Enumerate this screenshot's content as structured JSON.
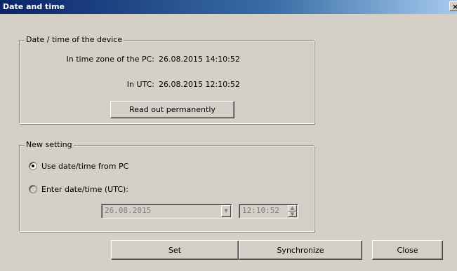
{
  "window": {
    "title": "Date and time",
    "close_glyph": "×"
  },
  "device_group": {
    "legend": "Date / time of the device",
    "pc_label": "In time zone of the PC:",
    "pc_value": "26.08.2015 14:10:52",
    "utc_label": "In UTC:",
    "utc_value": "26.08.2015 12:10:52",
    "read_button": "Read out permanently"
  },
  "new_setting_group": {
    "legend": "New setting",
    "option_pc": {
      "label": "Use date/time from PC",
      "checked": true
    },
    "option_manual": {
      "label": "Enter date/time (UTC):",
      "checked": false
    },
    "date_value": "26.08.2015",
    "time_value": "12:10:52"
  },
  "buttons": {
    "set": "Set",
    "synchronize": "Synchronize",
    "close": "Close"
  },
  "icons": {
    "dropdown": "chevron-down-icon",
    "spin_up": "arrow-up-icon",
    "spin_down": "arrow-down-icon",
    "close": "close-icon"
  }
}
